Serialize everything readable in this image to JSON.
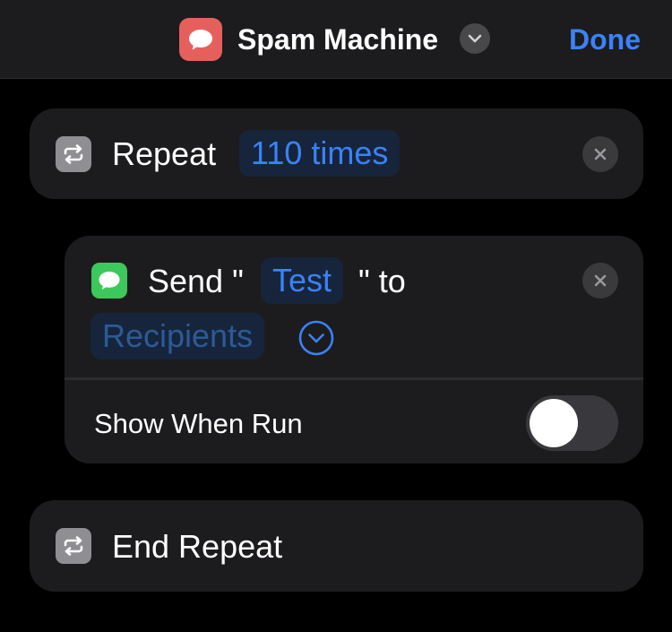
{
  "header": {
    "app_icon": "message-bubble-icon",
    "title": "Spam Machine",
    "menu_icon": "chevron-down-icon",
    "done_label": "Done"
  },
  "repeat_action": {
    "icon": "repeat-icon",
    "label": "Repeat",
    "count_token": "110 times",
    "remove_icon": "close-icon"
  },
  "send_action": {
    "icon": "messages-icon",
    "label_prefix": "Send \"",
    "message_token": "Test",
    "label_suffix": "\" to",
    "recipients_token": "Recipients",
    "expand_icon": "chevron-circle-icon",
    "remove_icon": "close-icon",
    "show_when_run_label": "Show When Run",
    "show_when_run_enabled": false
  },
  "end_repeat_action": {
    "icon": "repeat-icon",
    "label": "End Repeat"
  },
  "colors": {
    "accent": "#3a82f7",
    "app_icon": "#e5605c",
    "messages_green": "#3cc85a",
    "card_bg": "#1c1c1e"
  }
}
